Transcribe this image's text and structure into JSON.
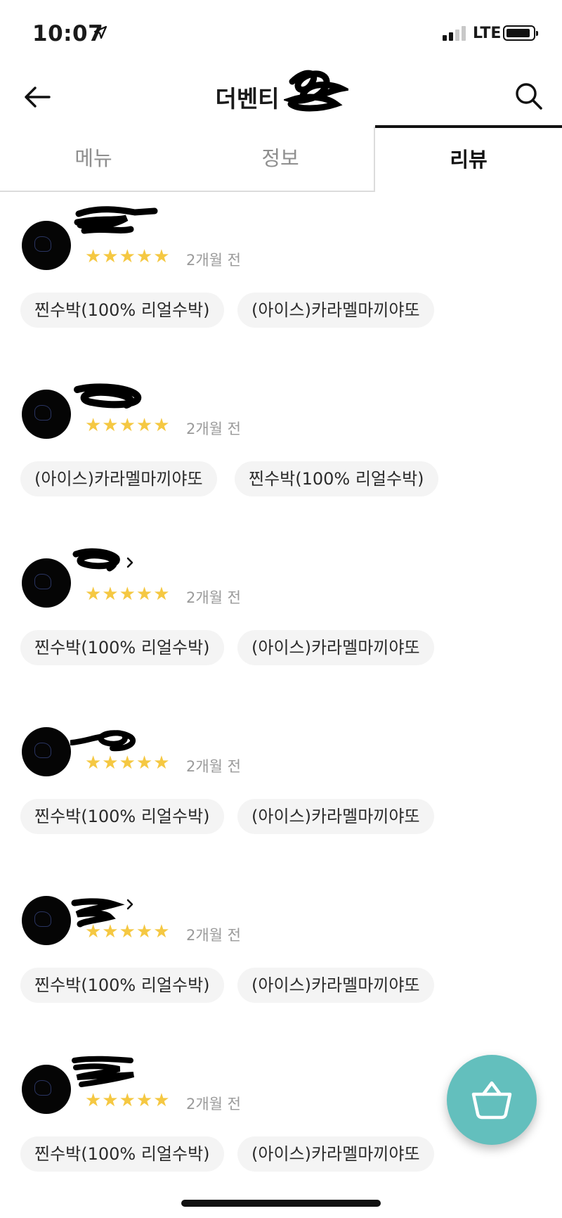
{
  "status_bar": {
    "time": "10:07",
    "network": "LTE"
  },
  "header": {
    "title": "더벤티"
  },
  "tabs": [
    {
      "label": "메뉴",
      "active": false
    },
    {
      "label": "정보",
      "active": false
    },
    {
      "label": "리뷰",
      "active": true
    }
  ],
  "reviews": [
    {
      "rating": 5,
      "stars": "★★★★★",
      "date": "2개월 전",
      "menu_items": [
        "찐수박(100% 리얼수박)",
        "(아이스)카라멜마끼야또"
      ]
    },
    {
      "rating": 5,
      "stars": "★★★★★",
      "date": "2개월 전",
      "menu_items": [
        "(아이스)카라멜마끼야또",
        "찐수박(100% 리얼수박)"
      ]
    },
    {
      "rating": 5,
      "stars": "★★★★★",
      "date": "2개월 전",
      "menu_items": [
        "찐수박(100% 리얼수박)",
        "(아이스)카라멜마끼야또"
      ]
    },
    {
      "rating": 5,
      "stars": "★★★★★",
      "date": "2개월 전",
      "menu_items": [
        "찐수박(100% 리얼수박)",
        "(아이스)카라멜마끼야또"
      ]
    },
    {
      "rating": 5,
      "stars": "★★★★★",
      "date": "2개월 전",
      "menu_items": [
        "찐수박(100% 리얼수박)",
        "(아이스)카라멜마끼야또"
      ]
    },
    {
      "rating": 5,
      "stars": "★★★★★",
      "date": "2개월 전",
      "menu_items": [
        "찐수박(100% 리얼수박)",
        "(아이스)카라멜마끼야또"
      ]
    }
  ],
  "icons": {
    "back": "arrow-left-icon",
    "search": "search-icon",
    "cart": "basket-icon",
    "location": "location-arrow-icon"
  },
  "colors": {
    "star": "#f5c842",
    "fab": "#63bfbd",
    "active_tab": "#111111",
    "inactive_tab": "#8f8f8f"
  }
}
